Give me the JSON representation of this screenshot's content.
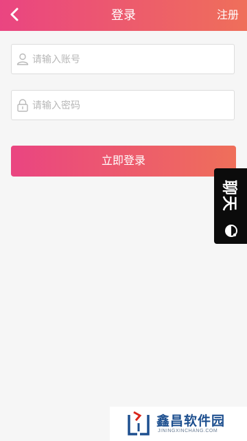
{
  "header": {
    "title": "登录",
    "register_label": "注册",
    "back_icon": "chevron-left-icon",
    "gradient_start": "#ea4581",
    "gradient_end": "#ef6f5a"
  },
  "form": {
    "account": {
      "placeholder": "请输入账号",
      "value": "",
      "icon": "user-icon"
    },
    "password": {
      "placeholder": "请输入密码",
      "value": "",
      "icon": "lock-icon"
    },
    "submit_label": "立即登录"
  },
  "chat_tab": {
    "label": "聊天",
    "icon": "chat-bubble-icon",
    "background": "#0b0b0b"
  },
  "watermark": {
    "title": "鑫昌软件园",
    "subtitle": "JININGXINCHANG.COM"
  }
}
